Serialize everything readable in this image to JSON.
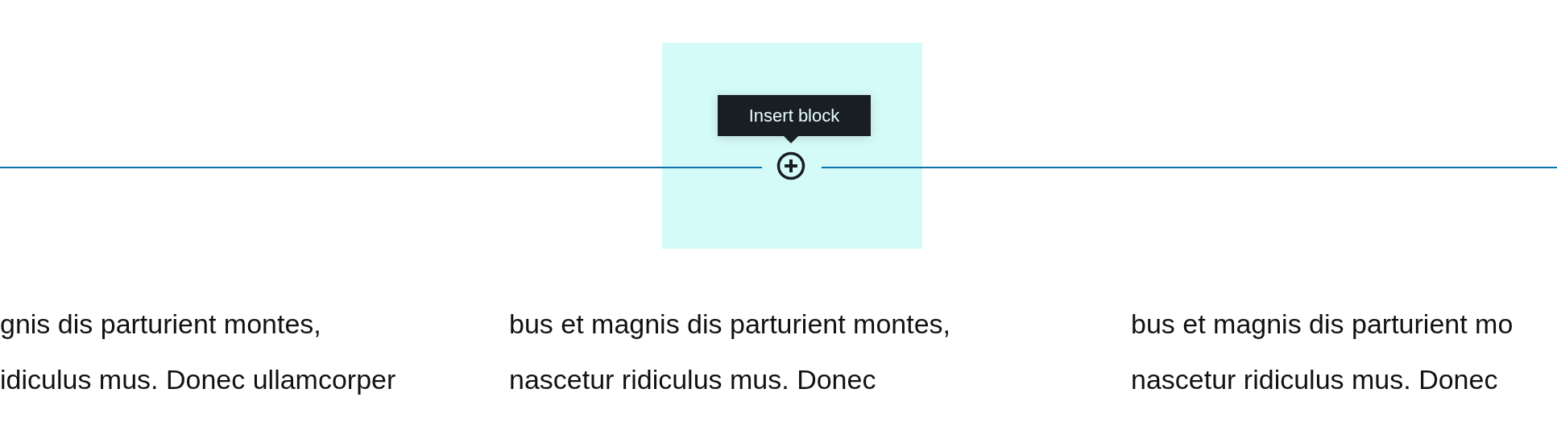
{
  "inserter": {
    "tooltip": "Insert block",
    "highlighted": true
  },
  "columns": [
    {
      "lines": [
        "gnis dis parturient montes,",
        "idiculus mus. Donec ullamcorper"
      ]
    },
    {
      "lines": [
        "bus et magnis dis parturient montes,",
        "nascetur ridiculus mus. Donec"
      ]
    },
    {
      "lines": [
        "bus et magnis dis parturient mo",
        "nascetur ridiculus mus. Donec"
      ]
    }
  ]
}
